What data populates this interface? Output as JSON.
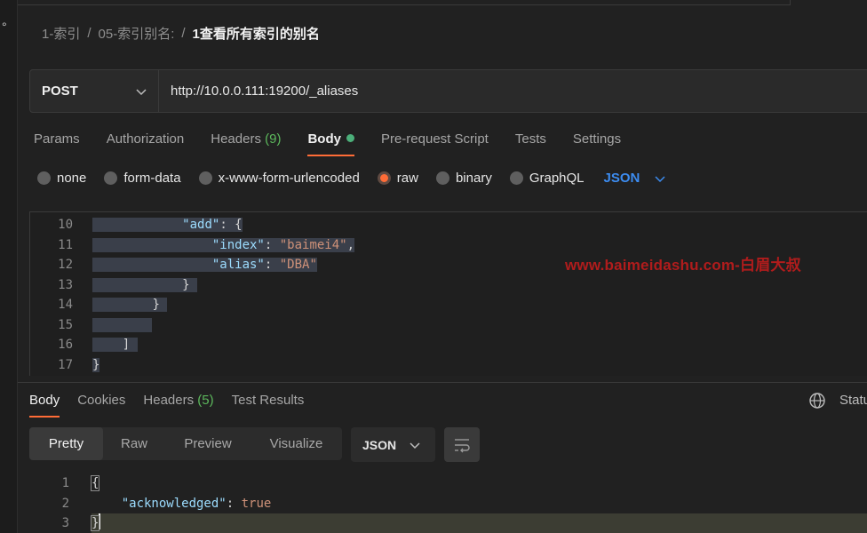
{
  "left_fragment": "°",
  "breadcrumb": {
    "items": [
      "1-索引",
      "05-索引别名:"
    ],
    "separator": "/",
    "current": "1查看所有索引的别名"
  },
  "request": {
    "method": "POST",
    "url": "http://10.0.0.111:19200/_aliases"
  },
  "request_tabs": [
    {
      "label": "Params"
    },
    {
      "label": "Authorization"
    },
    {
      "label": "Headers",
      "count": "(9)"
    },
    {
      "label": "Body",
      "active": true
    },
    {
      "label": "Pre-request Script"
    },
    {
      "label": "Tests"
    },
    {
      "label": "Settings"
    }
  ],
  "body_types": [
    "none",
    "form-data",
    "x-www-form-urlencoded",
    "raw",
    "binary",
    "GraphQL"
  ],
  "body_type_selected": "raw",
  "body_language": "JSON",
  "editor": {
    "line_numbers": [
      "10",
      "11",
      "12",
      "13",
      "14",
      "15",
      "16",
      "17"
    ],
    "lines": {
      "l10_key": "\"add\"",
      "l10_rest": ": {",
      "l11_key": "\"index\"",
      "l11_sep": ": ",
      "l11_val": "\"baimei4\"",
      "l11_end": ",",
      "l12_key": "\"alias\"",
      "l12_sep": ": ",
      "l12_val": "\"DBA\"",
      "l13": "}",
      "l14": "}",
      "l15": "",
      "l16": "]",
      "l17": "}"
    }
  },
  "watermark": "www.baimeidashu.com-白眉大叔",
  "response_tabs": [
    {
      "label": "Body",
      "active": true
    },
    {
      "label": "Cookies"
    },
    {
      "label": "Headers",
      "count": "(5)"
    },
    {
      "label": "Test Results"
    }
  ],
  "status_label": "Statu",
  "view_modes": [
    "Pretty",
    "Raw",
    "Preview",
    "Visualize"
  ],
  "view_mode_selected": "Pretty",
  "response_format": "JSON",
  "response": {
    "line_numbers": [
      "1",
      "2",
      "3"
    ],
    "l1": "{",
    "l2_key": "\"acknowledged\"",
    "l2_sep": ": ",
    "l2_val": "true",
    "l3": "}"
  },
  "colors": {
    "accent": "#ff6c37",
    "count_green": "#5cb85c",
    "json_blue": "#3c8cf0",
    "watermark_red": "#b01c1c"
  }
}
